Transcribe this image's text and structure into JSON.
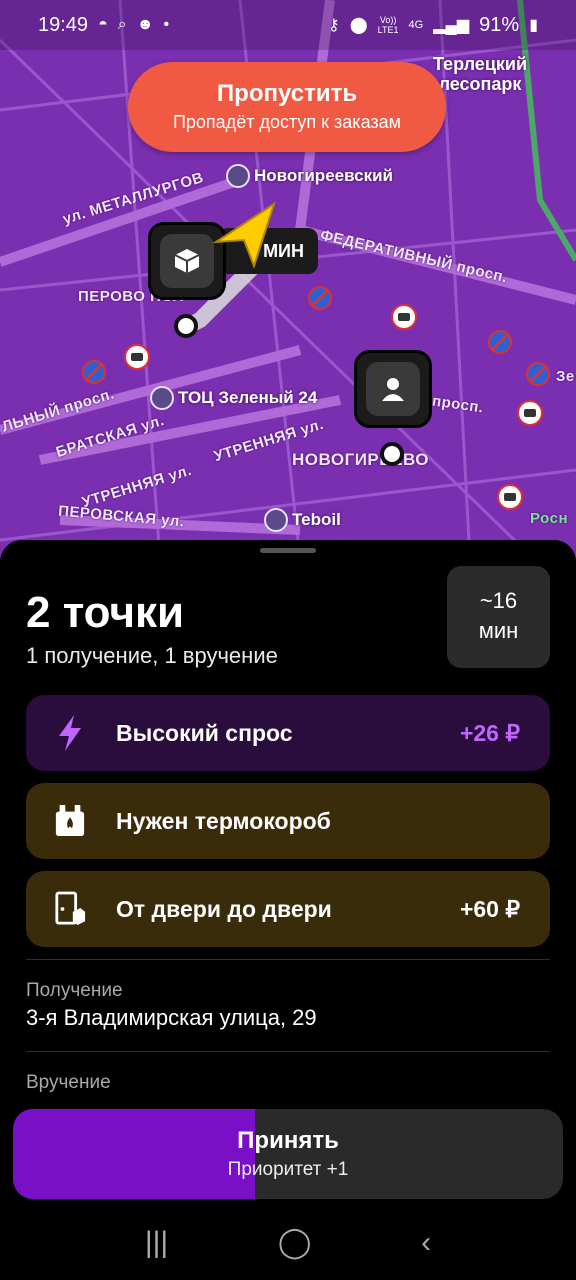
{
  "status_bar": {
    "time": "19:49",
    "battery": "91%",
    "net_a": "Vo))",
    "net_b": "LTE1",
    "net_c": "4G"
  },
  "skip_button": {
    "title": "Пропустить",
    "subtitle": "Пропадёт доступ к заказам"
  },
  "map": {
    "streets": [
      "ул. МЕТАЛЛУРГОВ",
      "ФЕДЕРАТИВНЫЙ просп.",
      "ПЕРОВО ПОЛ",
      "БРАТСКАЯ ул.",
      "УТРЕННЯЯ ул.",
      "УТРЕННЯЯ ул.",
      "ПЕРОВСКАЯ ул.",
      "ЛЬНЫЙ просп.",
      "просп.",
      "НОВОГИРЕЕВО",
      "Зе",
      "Росн"
    ],
    "pois": [
      "Новогиреевский",
      "ТОЦ Зеленый 24",
      "Teboil",
      "Терлецкий лесопарк"
    ],
    "eta_chip": "МИН"
  },
  "order": {
    "title": "2 точки",
    "subtitle": "1 получение, 1 вручение",
    "time_value": "~16",
    "time_unit": "мин"
  },
  "cards": [
    {
      "label": "Высокий спрос",
      "value": "+26 ₽",
      "icon": "lightning-icon"
    },
    {
      "label": "Нужен термокороб",
      "value": "",
      "icon": "thermobox-icon"
    },
    {
      "label": "От двери до двери",
      "value": "+60 ₽",
      "icon": "door-to-door-icon"
    }
  ],
  "pickup": {
    "label": "Получение",
    "address": "3-я Владимирская улица, 29"
  },
  "delivery": {
    "label": "Вручение"
  },
  "accept_button": {
    "title": "Принять",
    "subtitle": "Приоритет +1",
    "hold_progress": 0.44
  },
  "colors": {
    "accent": "#7a0fc8",
    "skip": "#f05a42",
    "high_demand": "#c065ff"
  }
}
